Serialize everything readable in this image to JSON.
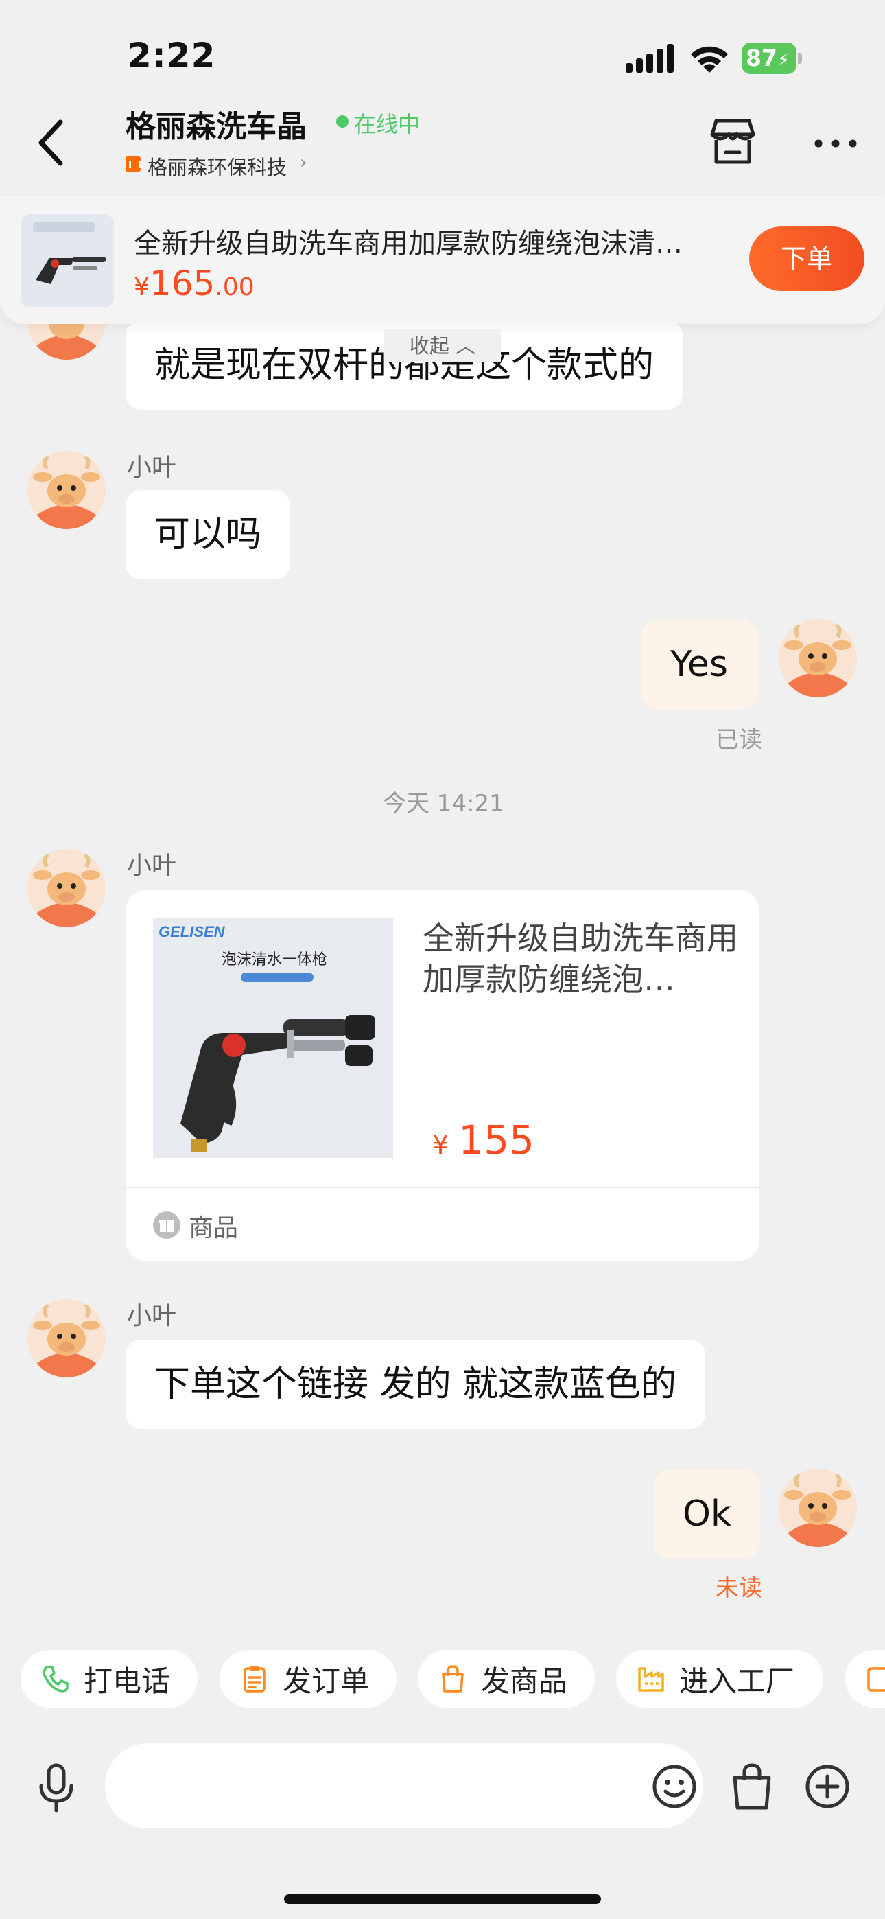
{
  "status_bar": {
    "time": "2:22",
    "battery": "87"
  },
  "header": {
    "title": "格丽森洗车晶",
    "online_status": "在线中",
    "company": "格丽森环保科技",
    "company_chevron": "›"
  },
  "product_bar": {
    "title": "全新升级自助洗车商用加厚款防缠绕泡沫清…",
    "price_currency": "¥",
    "price_int": "165",
    "price_dec": ".00",
    "order_button": "下单",
    "collapse_label": "收起 ︿"
  },
  "messages": [
    {
      "sender": "",
      "text": "就是现在双杆的都是这个款式的",
      "mine": false
    },
    {
      "sender": "小叶",
      "text": "可以吗",
      "mine": false
    },
    {
      "text": "Yes",
      "mine": true,
      "status": "已读"
    },
    {
      "timestamp": "今天 14:21"
    },
    {
      "sender": "小叶",
      "type": "product_card"
    },
    {
      "sender": "小叶",
      "text": "下单这个链接 发的 就这款蓝色的",
      "mine": false
    },
    {
      "text": "Ok",
      "mine": true,
      "status": "未读"
    }
  ],
  "product_card": {
    "title": "全新升级自助洗车商用加厚款防缠绕泡…",
    "price_currency": "¥",
    "price": "155",
    "tag": "商品",
    "image_brand": "GELISEN",
    "image_caption": "泡沫清水一体枪"
  },
  "quick_actions": [
    {
      "label": "打电话",
      "icon": "phone-icon",
      "color": "#4cc969"
    },
    {
      "label": "发订单",
      "icon": "clipboard-icon",
      "color": "#ff8a1f"
    },
    {
      "label": "发商品",
      "icon": "bag-icon",
      "color": "#ff8a1f"
    },
    {
      "label": "进入工厂",
      "icon": "factory-icon",
      "color": "#f0b21f"
    }
  ],
  "input_bar": {
    "placeholder": ""
  }
}
